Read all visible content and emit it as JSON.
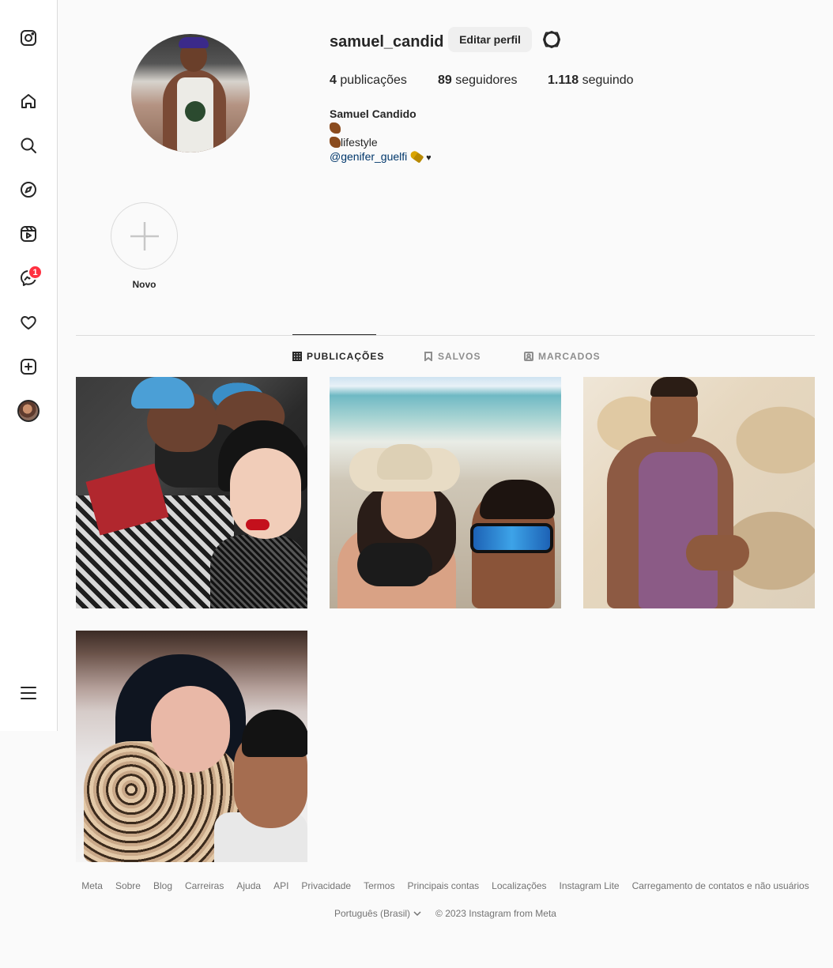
{
  "sidebar": {
    "icons": [
      "instagram-logo-icon",
      "home-icon",
      "search-icon",
      "explore-icon",
      "reels-icon",
      "messenger-icon",
      "heart-icon",
      "create-icon",
      "profile-avatar",
      "menu-icon"
    ],
    "messages_badge": "1"
  },
  "profile": {
    "username": "samuel_candid",
    "edit_button": "Editar perfil",
    "stats": {
      "posts_count": "4",
      "posts_label": "publicações",
      "followers_count": "89",
      "followers_label": "seguidores",
      "following_count": "1.118",
      "following_label": "seguindo"
    },
    "bio": {
      "name": "Samuel Candido",
      "line2_text": "lifestyle",
      "mention": "@genifer_guelfi",
      "heart": "♥"
    }
  },
  "highlights": {
    "new_label": "Novo"
  },
  "tabs": [
    {
      "label": "PUBLICAÇÕES",
      "active": true
    },
    {
      "label": "SALVOS",
      "active": false
    },
    {
      "label": "MARCADOS",
      "active": false
    }
  ],
  "posts_count": 4,
  "footer": {
    "links": [
      "Meta",
      "Sobre",
      "Blog",
      "Carreiras",
      "Ajuda",
      "API",
      "Privacidade",
      "Termos",
      "Principais contas",
      "Localizações",
      "Instagram Lite",
      "Carregamento de contatos e não usuários"
    ],
    "language": "Português (Brasil)",
    "copyright": "© 2023 Instagram from Meta"
  },
  "colors": {
    "badge": "#ff3040",
    "link": "#00376b",
    "background": "#fafafa"
  }
}
